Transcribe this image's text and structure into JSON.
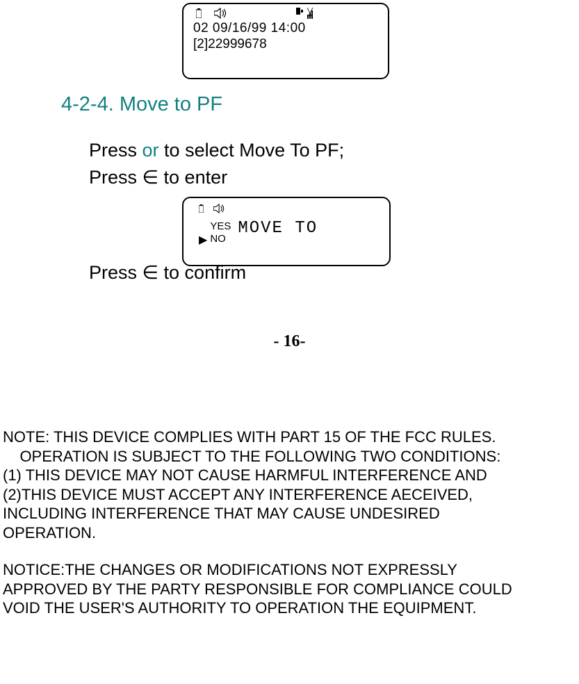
{
  "screen1": {
    "line1": " 02     09/16/99     14:00",
    "line2": "[2]22999678"
  },
  "section_title": "4-2-4. Move to PF",
  "instructions": {
    "line1_a": "Press  ",
    "line1_or": "or",
    "line1_b": "   to select Move To PF;",
    "line2": "Press ∈ to enter"
  },
  "screen2": {
    "yes": "YES",
    "no": "NO",
    "move_to": "MOVE TO"
  },
  "press_confirm": "Press ∈ to confirm",
  "page_num": "- 16-",
  "note": {
    "l1": "NOTE: THIS DEVICE COMPLIES WITH PART 15 OF THE FCC RULES.",
    "l2": "    OPERATION IS SUBJECT TO THE FOLLOWING TWO CONDITIONS:",
    "l3": "(1) THIS DEVICE MAY NOT CAUSE HARMFUL INTERFERENCE AND",
    "l4": "(2)THIS DEVICE MUST ACCEPT ANY INTERFERENCE AECEIVED,",
    "l5": "INCLUDING INTERFERENCE THAT MAY CAUSE UNDESIRED",
    "l6": "OPERATION."
  },
  "notice": {
    "l1": "NOTICE:THE CHANGES OR MODIFICATIONS NOT EXPRESSLY",
    "l2": "APPROVED BY THE PARTY RESPONSIBLE FOR COMPLIANCE COULD",
    "l3": "VOID THE USER'S AUTHORITY TO OPERATION THE EQUIPMENT."
  }
}
